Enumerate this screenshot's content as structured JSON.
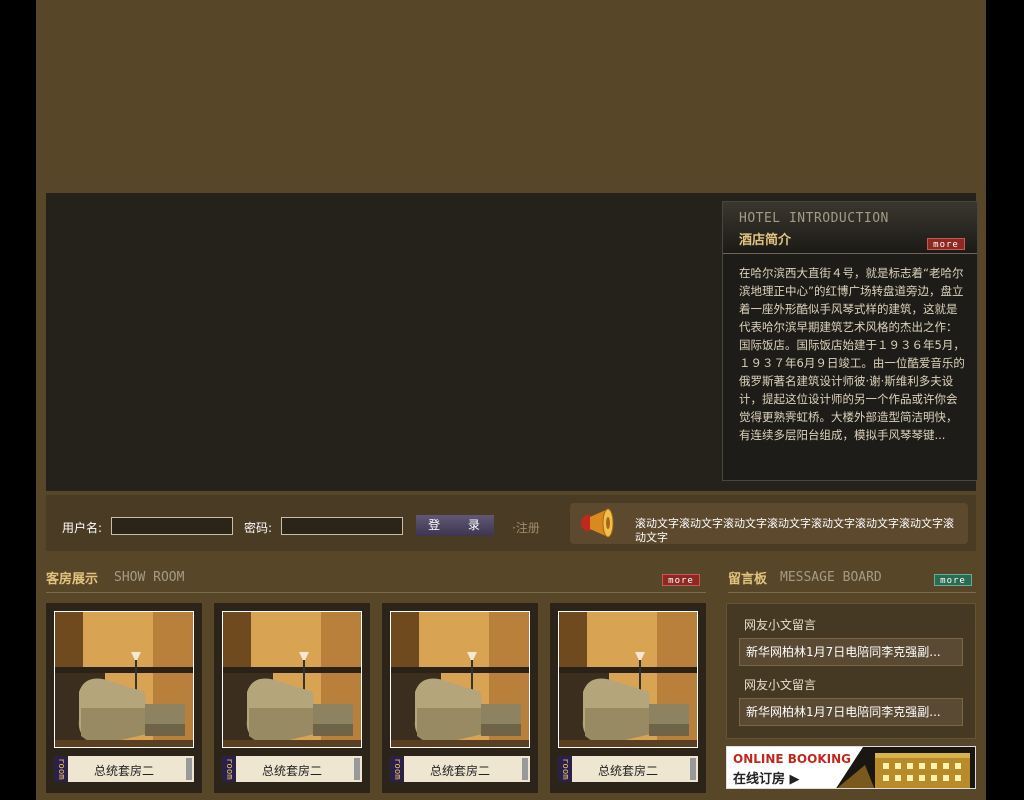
{
  "intro": {
    "title_en": "HOTEL INTRODUCTION",
    "title_cn": "酒店简介",
    "more": "more",
    "body": "在哈尔滨西大直街４号，就是标志着“老哈尔滨地理正中心”的红博广场转盘道旁边，盘立着一座外形酷似手风琴式样的建筑，这就是代表哈尔滨早期建筑艺术风格的杰出之作：国际饭店。国际饭店始建于１９３６年5月，１９３７年6月９日竣工。由一位酷爱音乐的俄罗斯著名建筑设计师彼·谢·斯维利多夫设计，提起这位设计师的另一个作品或许你会觉得更熟霁虹桥。大楼外部造型简洁明快，有连续多层阳台组成，模拟手风琴琴键..."
  },
  "login": {
    "username_label": "用户名:",
    "password_label": "密码:",
    "login_button": "登 录",
    "register": "·注册"
  },
  "marquee": {
    "text": "滚动文字滚动文字滚动文字滚动文字滚动文字滚动文字滚动文字滚动文字"
  },
  "rooms": {
    "title_cn": "客房展示",
    "title_en": "SHOW ROOM",
    "more": "more",
    "tag": "room",
    "items": [
      {
        "name": "总统套房二"
      },
      {
        "name": "总统套房二"
      },
      {
        "name": "总统套房二"
      },
      {
        "name": "总统套房二"
      }
    ]
  },
  "board": {
    "title_cn": "留言板",
    "title_en": "MESSAGE BOARD",
    "more": "more",
    "entries": [
      {
        "title": "网友小文留言",
        "content": "新华网柏林1月7日电陪同李克强副..."
      },
      {
        "title": "网友小文留言",
        "content": "新华网柏林1月7日电陪同李克强副..."
      }
    ]
  },
  "booking": {
    "en": "ONLINE BOOKING",
    "cn": "在线订房 ▶"
  }
}
